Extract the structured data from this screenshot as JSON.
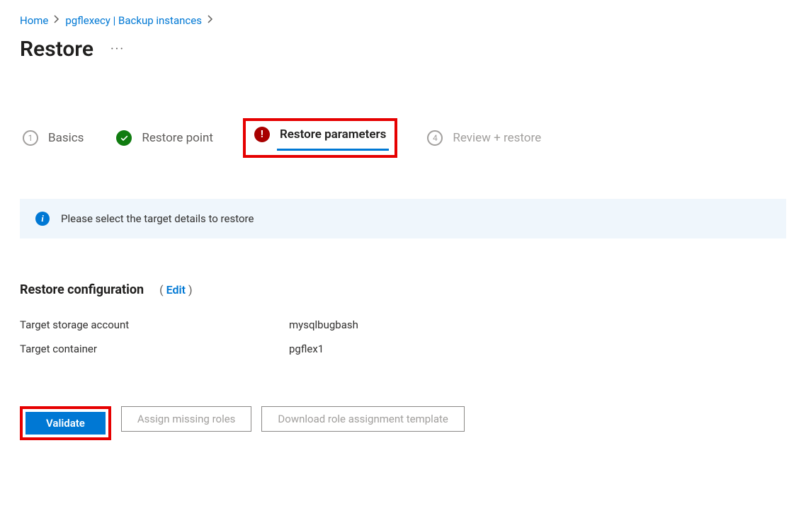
{
  "breadcrumb": {
    "home": "Home",
    "item1": "pgflexecy | Backup instances"
  },
  "page": {
    "title": "Restore",
    "more": "···"
  },
  "tabs": {
    "basics": {
      "num": "1",
      "label": "Basics"
    },
    "restorepoint": {
      "label": "Restore point"
    },
    "restoreparams": {
      "label": "Restore parameters"
    },
    "review": {
      "num": "4",
      "label": "Review + restore"
    }
  },
  "banner": {
    "text": "Please select the target details to restore"
  },
  "section": {
    "heading": "Restore configuration",
    "edit_label": "Edit"
  },
  "config": {
    "storage_label": "Target storage account",
    "storage_value": "mysqlbugbash",
    "container_label": "Target container",
    "container_value": "pgflex1"
  },
  "buttons": {
    "validate": "Validate",
    "assign_roles": "Assign missing roles",
    "download_template": "Download role assignment template"
  }
}
